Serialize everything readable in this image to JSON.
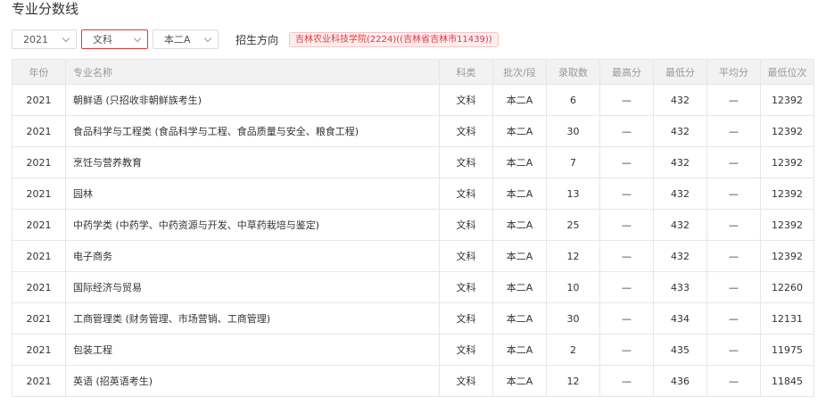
{
  "page_title": "专业分数线",
  "filters": {
    "year": "2021",
    "subject": "文科",
    "batch": "本二A",
    "direction_label": "招生方向",
    "direction_tag": "吉林农业科技学院(2224)((吉林省吉林市11439))"
  },
  "table": {
    "headers": [
      "年份",
      "专业名称",
      "科类",
      "批次/段",
      "录取数",
      "最高分",
      "最低分",
      "平均分",
      "最低位次"
    ],
    "rows": [
      {
        "year": "2021",
        "name": "朝鲜语 (只招收非朝鲜族考生)",
        "category": "文科",
        "batch": "本二A",
        "count": "6",
        "max": "—",
        "min": "432",
        "avg": "—",
        "rank": "12392"
      },
      {
        "year": "2021",
        "name": "食品科学与工程类 (食品科学与工程、食品质量与安全、粮食工程)",
        "category": "文科",
        "batch": "本二A",
        "count": "30",
        "max": "—",
        "min": "432",
        "avg": "—",
        "rank": "12392"
      },
      {
        "year": "2021",
        "name": "烹饪与营养教育",
        "category": "文科",
        "batch": "本二A",
        "count": "7",
        "max": "—",
        "min": "432",
        "avg": "—",
        "rank": "12392"
      },
      {
        "year": "2021",
        "name": "园林",
        "category": "文科",
        "batch": "本二A",
        "count": "13",
        "max": "—",
        "min": "432",
        "avg": "—",
        "rank": "12392"
      },
      {
        "year": "2021",
        "name": "中药学类 (中药学、中药资源与开发、中草药栽培与鉴定)",
        "category": "文科",
        "batch": "本二A",
        "count": "25",
        "max": "—",
        "min": "432",
        "avg": "—",
        "rank": "12392"
      },
      {
        "year": "2021",
        "name": "电子商务",
        "category": "文科",
        "batch": "本二A",
        "count": "12",
        "max": "—",
        "min": "432",
        "avg": "—",
        "rank": "12392"
      },
      {
        "year": "2021",
        "name": "国际经济与贸易",
        "category": "文科",
        "batch": "本二A",
        "count": "10",
        "max": "—",
        "min": "433",
        "avg": "—",
        "rank": "12260"
      },
      {
        "year": "2021",
        "name": "工商管理类 (财务管理、市场营销、工商管理)",
        "category": "文科",
        "batch": "本二A",
        "count": "30",
        "max": "—",
        "min": "434",
        "avg": "—",
        "rank": "12131"
      },
      {
        "year": "2021",
        "name": "包装工程",
        "category": "文科",
        "batch": "本二A",
        "count": "2",
        "max": "—",
        "min": "435",
        "avg": "—",
        "rank": "11975"
      },
      {
        "year": "2021",
        "name": "英语 (招英语考生)",
        "category": "文科",
        "batch": "本二A",
        "count": "12",
        "max": "—",
        "min": "436",
        "avg": "—",
        "rank": "11845"
      }
    ]
  },
  "colors": {
    "accent": "#e0373e",
    "header_bg": "#f2f2f2",
    "border": "#e6e6e6"
  },
  "icons": {
    "dropdown": "chevron-down-icon"
  }
}
